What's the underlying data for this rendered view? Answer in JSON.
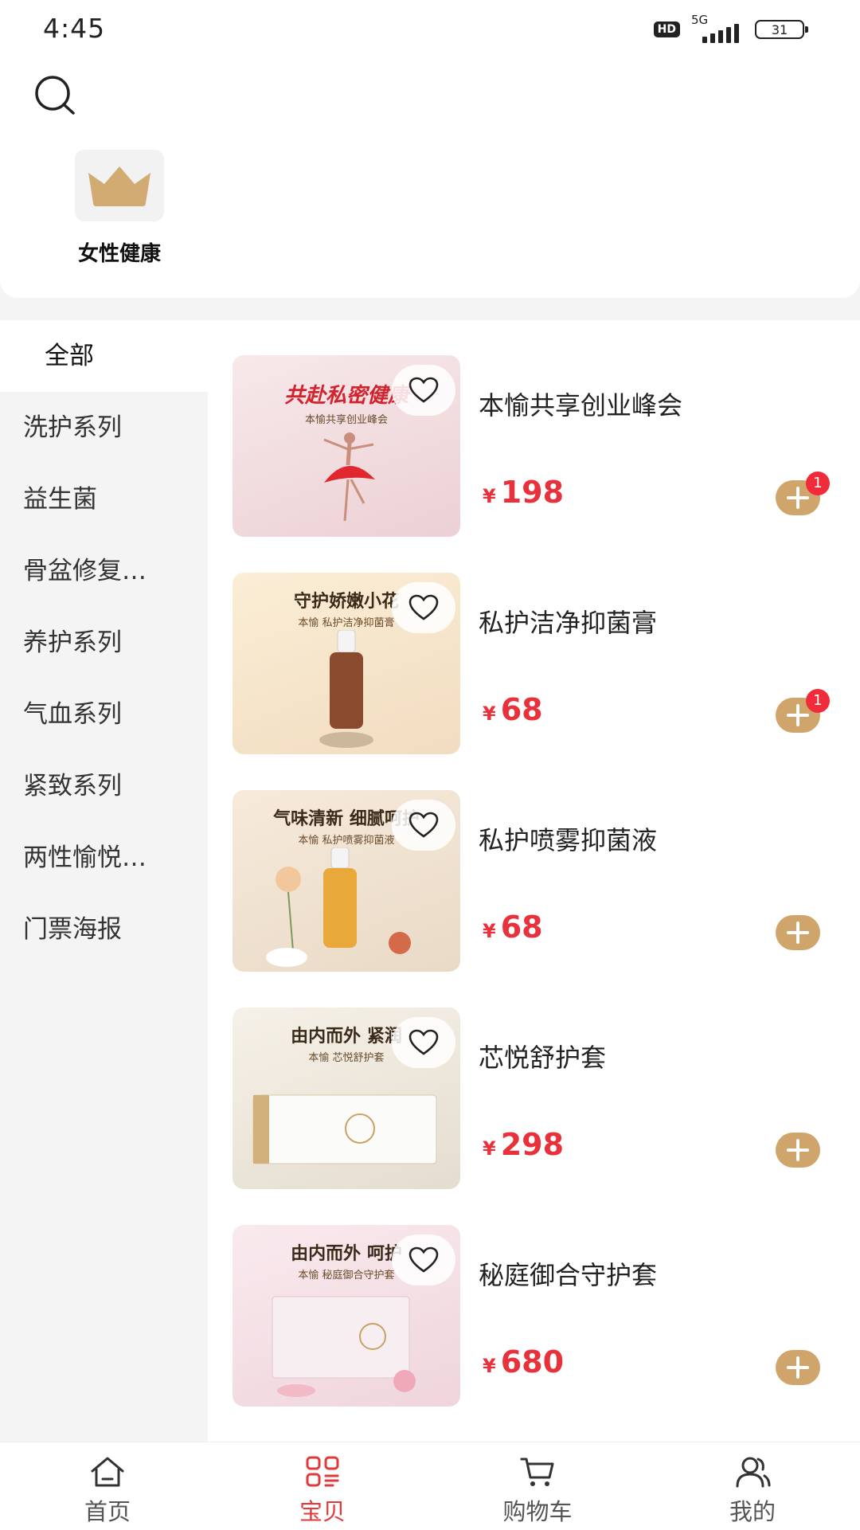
{
  "status_bar": {
    "time": "4:45",
    "hd": "HD",
    "network": "5G",
    "battery": "31"
  },
  "category_tab": {
    "label": "女性健康"
  },
  "sidebar": {
    "items": [
      "全部",
      "洗护系列",
      "益生菌",
      "骨盆修复…",
      "养护系列",
      "气血系列",
      "紧致系列",
      "两性愉悦…",
      "门票海报"
    ],
    "active_index": 0
  },
  "currency": "¥",
  "products": [
    {
      "name": "本愉共享创业峰会",
      "price": "198",
      "badge": "1",
      "image_caption": "共赴私密健康",
      "image_sub": "本愉共享创业峰会",
      "image_bg": "#f3dde0"
    },
    {
      "name": "私护洁净抑菌膏",
      "price": "68",
      "badge": "1",
      "image_caption": "守护娇嫩小花",
      "image_sub": "本愉 私护洁净抑菌膏",
      "image_bg": "#f7e6cf"
    },
    {
      "name": "私护喷雾抑菌液",
      "price": "68",
      "badge": "",
      "image_caption": "气味清新 细腻呵护",
      "image_sub": "本愉 私护喷雾抑菌液",
      "image_bg": "#f3e6d6"
    },
    {
      "name": "芯悦舒护套",
      "price": "298",
      "badge": "",
      "image_caption": "由内而外 紧润",
      "image_sub": "本愉 芯悦舒护套",
      "image_bg": "#efe9df"
    },
    {
      "name": "秘庭御合守护套",
      "price": "680",
      "badge": "",
      "image_caption": "由内而外 呵护",
      "image_sub": "本愉 秘庭御合守护套",
      "image_bg": "#f4e1e6"
    }
  ],
  "bottom_nav": [
    {
      "label": "首页",
      "icon": "home-icon"
    },
    {
      "label": "宝贝",
      "icon": "grid-list-icon"
    },
    {
      "label": "购物车",
      "icon": "cart-icon"
    },
    {
      "label": "我的",
      "icon": "users-icon"
    }
  ],
  "bottom_nav_active": 1,
  "colors": {
    "accent_red": "#e8313b",
    "gold": "#cfa56b",
    "badge_red": "#f02b3a"
  }
}
